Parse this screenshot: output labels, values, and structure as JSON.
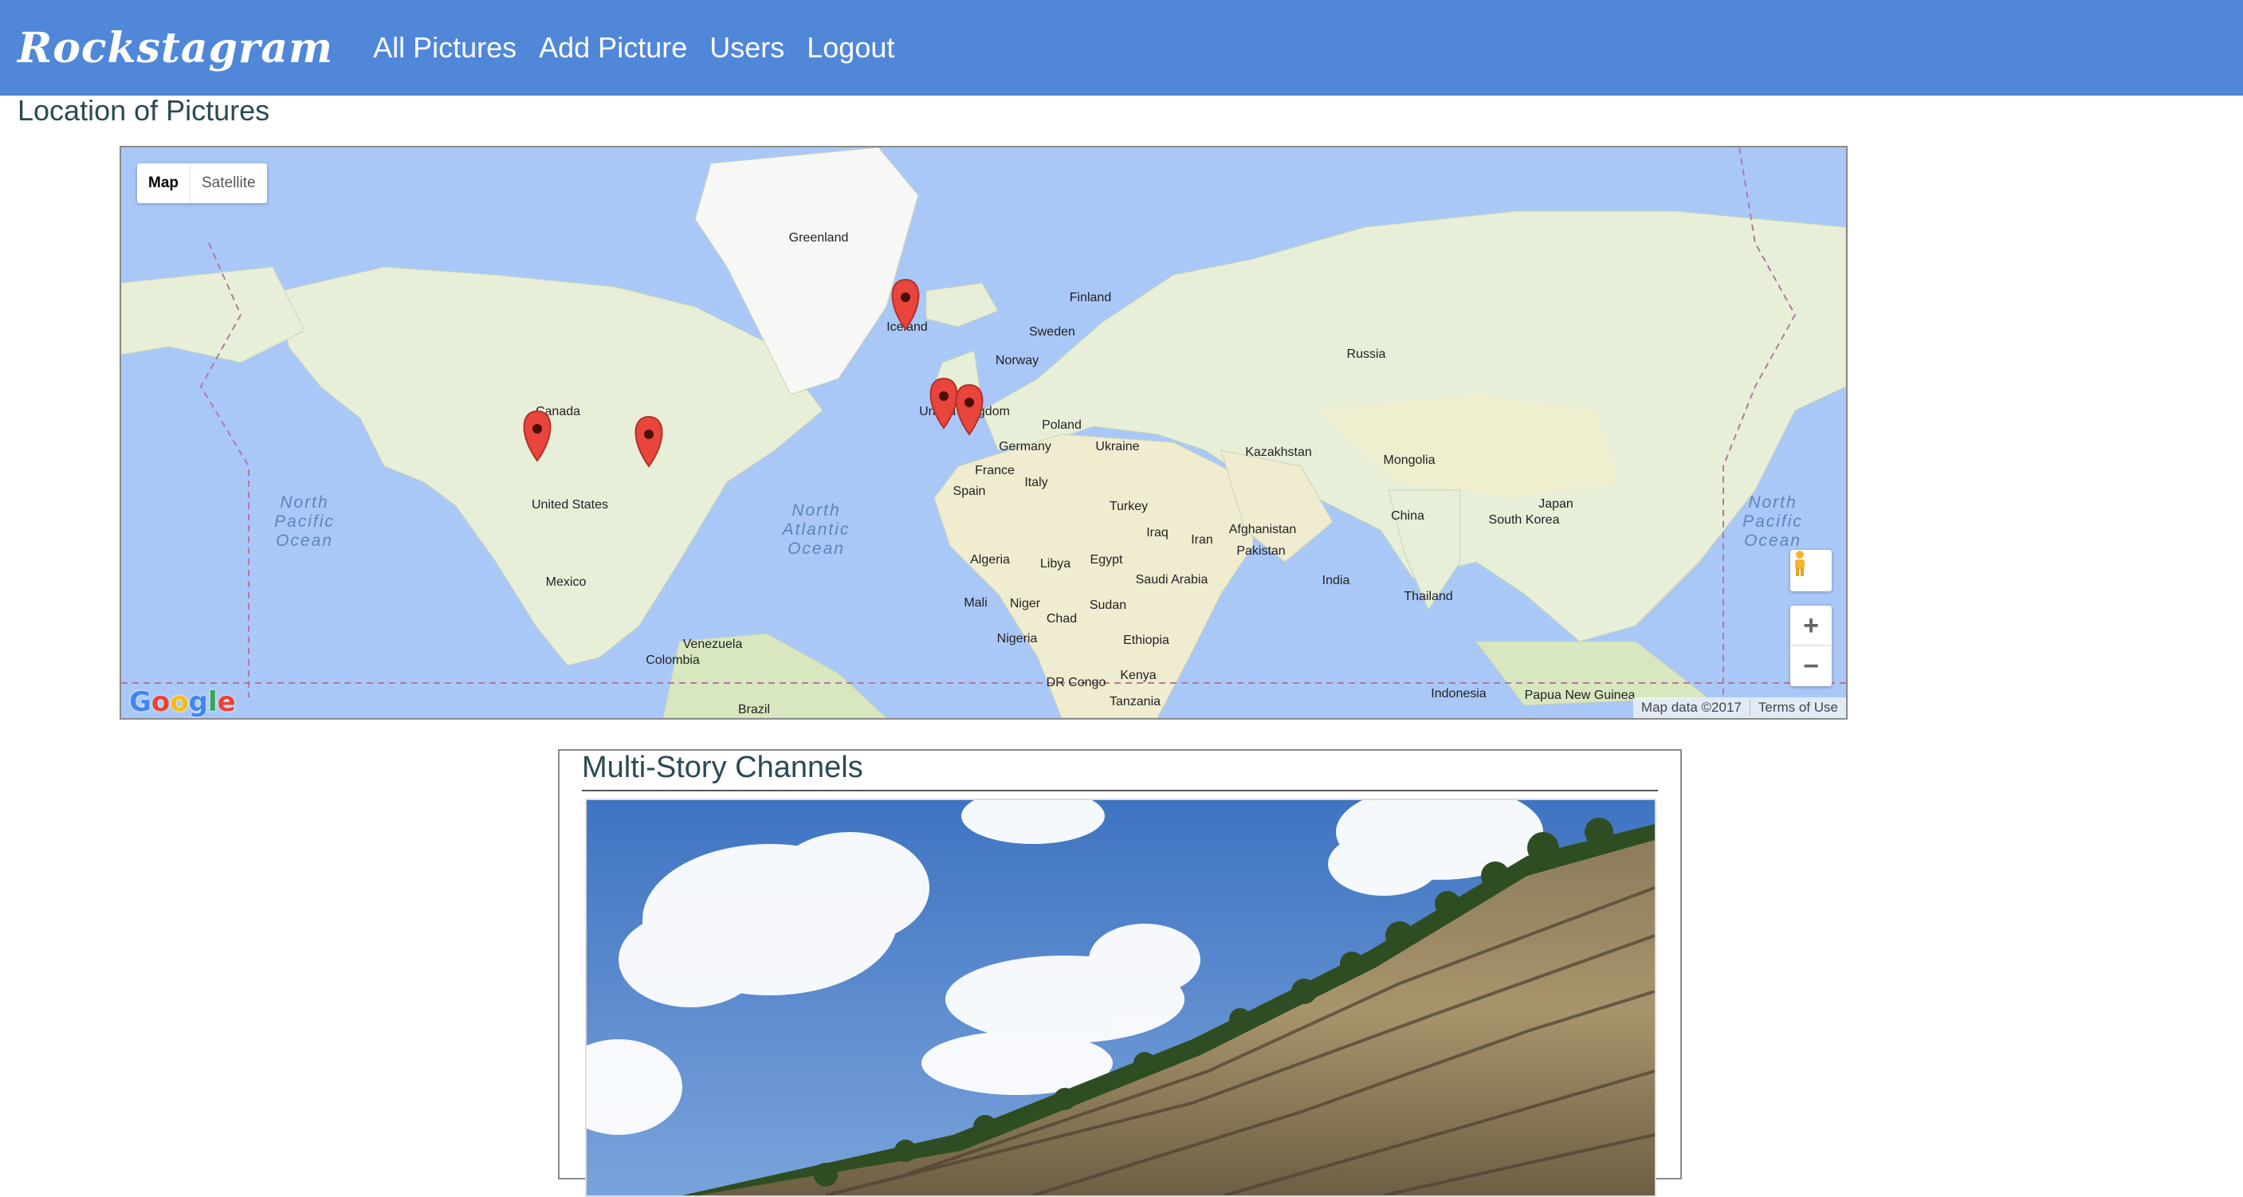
{
  "navbar": {
    "brand": "Rockstagram",
    "links": [
      "All Pictures",
      "Add Picture",
      "Users",
      "Logout"
    ]
  },
  "page": {
    "section_title": "Location of Pictures"
  },
  "map": {
    "type_buttons": [
      "Map",
      "Satellite"
    ],
    "zoom_in": "+",
    "zoom_out": "−",
    "logo": "Google",
    "attribution": "Map data ©2017",
    "terms": "Terms of Use",
    "countries": [
      "Greenland",
      "Iceland",
      "Finland",
      "Sweden",
      "Norway",
      "Russia",
      "Canada",
      "United States",
      "Mexico",
      "Poland",
      "Germany",
      "Ukraine",
      "France",
      "Italy",
      "Spain",
      "Kazakhstan",
      "Mongolia",
      "Turkey",
      "Iraq",
      "Iran",
      "Afghanistan",
      "Pakistan",
      "China",
      "Japan",
      "South Korea",
      "India",
      "Thailand",
      "Algeria",
      "Libya",
      "Egypt",
      "Saudi Arabia",
      "Mali",
      "Niger",
      "Chad",
      "Sudan",
      "Nigeria",
      "Ethiopia",
      "Kenya",
      "DR Congo",
      "Tanzania",
      "Venezuela",
      "Colombia",
      "Brazil",
      "Indonesia",
      "Papua New Guinea",
      "United Kingdom"
    ],
    "oceans": [
      "North Pacific Ocean",
      "North Atlantic Ocean",
      "North Pacific Ocean"
    ],
    "markers": [
      "marker-usa-west",
      "marker-usa-east",
      "marker-iceland",
      "marker-ireland",
      "marker-uk"
    ]
  },
  "card": {
    "title": "Multi-Story Channels"
  },
  "colors": {
    "navbar": "#5087d9",
    "marker": "#e8453c",
    "ocean": "#a9c8f7",
    "land": "#e8efd8"
  }
}
